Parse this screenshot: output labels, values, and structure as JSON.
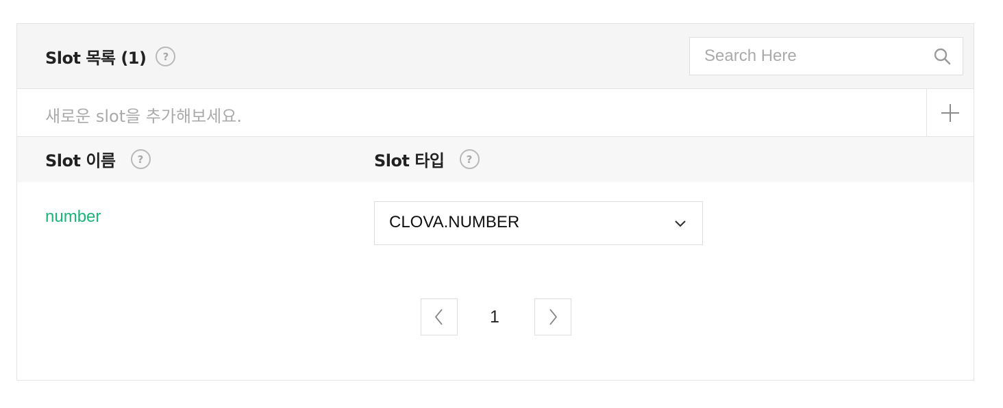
{
  "header": {
    "title": "Slot 목록 (1)",
    "help_glyph": "?",
    "search": {
      "placeholder": "Search Here",
      "value": "",
      "icon": "search-icon"
    }
  },
  "add_slot": {
    "placeholder": "새로운 slot을 추가해보세요.",
    "icon": "plus-icon"
  },
  "columns": [
    {
      "label": "Slot 이름",
      "help_glyph": "?"
    },
    {
      "label": "Slot 타입",
      "help_glyph": "?"
    }
  ],
  "rows": [
    {
      "name": "number",
      "type": "CLOVA.NUMBER"
    }
  ],
  "pagination": {
    "current_page": "1",
    "prev_icon": "chevron-left-icon",
    "next_icon": "chevron-right-icon"
  },
  "colors": {
    "slot_name": "#1eb377",
    "header_bg": "#f5f5f5",
    "border": "#e3e3e3"
  }
}
